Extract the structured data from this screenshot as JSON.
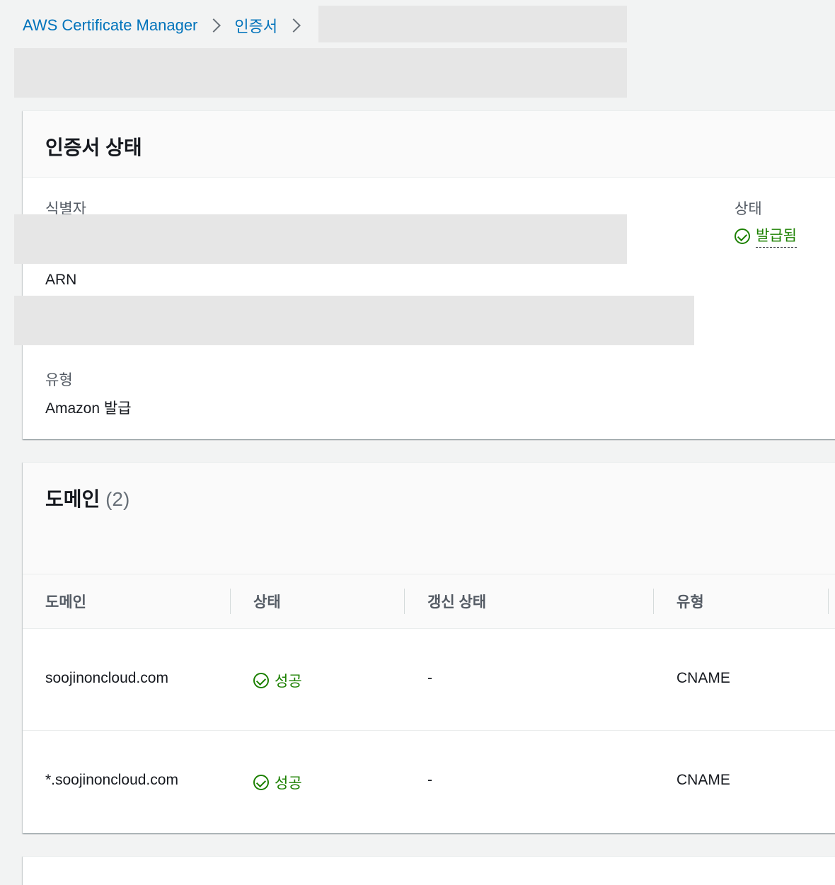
{
  "breadcrumb": {
    "root": "AWS Certificate Manager",
    "section": "인증서"
  },
  "status_panel": {
    "title": "인증서 상태",
    "identifier_label": "식별자",
    "arn_label": "ARN",
    "type_label": "유형",
    "type_value": "Amazon 발급",
    "status_label": "상태",
    "status_value": "발급됨"
  },
  "domains_panel": {
    "title": "도메인",
    "count": "(2)",
    "columns": [
      "도메인",
      "상태",
      "갱신 상태",
      "유형"
    ],
    "rows": [
      {
        "domain": "soojinoncloud.com",
        "status": "성공",
        "renewal": "-",
        "type": "CNAME"
      },
      {
        "domain": "*.soojinoncloud.com",
        "status": "성공",
        "renewal": "-",
        "type": "CNAME"
      }
    ]
  },
  "colors": {
    "link": "#0073bb",
    "success": "#1d8102",
    "background": "#f2f3f3",
    "redaction": "#e6e6e6"
  },
  "icons": {
    "breadcrumb_separator": "chevron-right-icon",
    "status": "check-circle-icon"
  }
}
